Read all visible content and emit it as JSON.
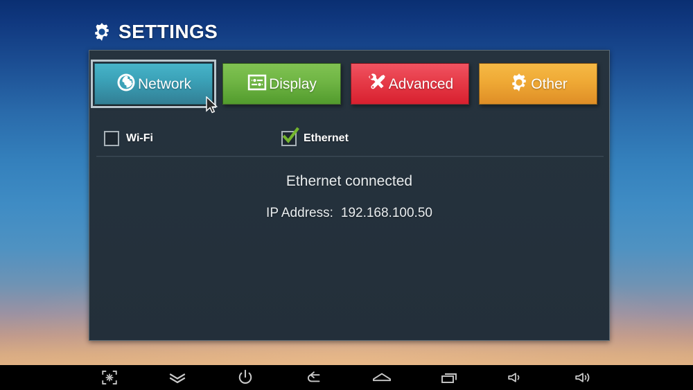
{
  "header": {
    "title": "SETTINGS",
    "icon": "gear-icon"
  },
  "tabs": [
    {
      "id": "network",
      "label": "Network",
      "icon": "globe-icon",
      "color": "#3ba2b8",
      "selected": true
    },
    {
      "id": "display",
      "label": "Display",
      "icon": "sliders-icon",
      "color": "#6fb544",
      "selected": false
    },
    {
      "id": "advanced",
      "label": "Advanced",
      "icon": "tools-icon",
      "color": "#e63b48",
      "selected": false
    },
    {
      "id": "other",
      "label": "Other",
      "icon": "gear-icon",
      "color": "#efa935",
      "selected": false
    }
  ],
  "network": {
    "options": [
      {
        "id": "wifi",
        "label": "Wi-Fi",
        "checked": false
      },
      {
        "id": "ethernet",
        "label": "Ethernet",
        "checked": true
      }
    ],
    "status_text": "Ethernet connected",
    "ip_label": "IP Address:",
    "ip_value": "192.168.100.50"
  },
  "navbar": {
    "buttons": [
      {
        "id": "screenshot",
        "icon": "screenshot-icon"
      },
      {
        "id": "collapse",
        "icon": "chevrons-down-icon"
      },
      {
        "id": "power",
        "icon": "power-icon"
      },
      {
        "id": "back",
        "icon": "back-arrow-icon"
      },
      {
        "id": "home",
        "icon": "home-icon"
      },
      {
        "id": "recents",
        "icon": "recent-apps-icon"
      },
      {
        "id": "volume-down",
        "icon": "volume-down-icon"
      },
      {
        "id": "volume-up",
        "icon": "volume-up-icon"
      }
    ]
  },
  "theme": {
    "panel_bg": "#24313c",
    "panel_border": "#5c6b75",
    "text": "#e9edef",
    "check_green": "#74b52e"
  }
}
